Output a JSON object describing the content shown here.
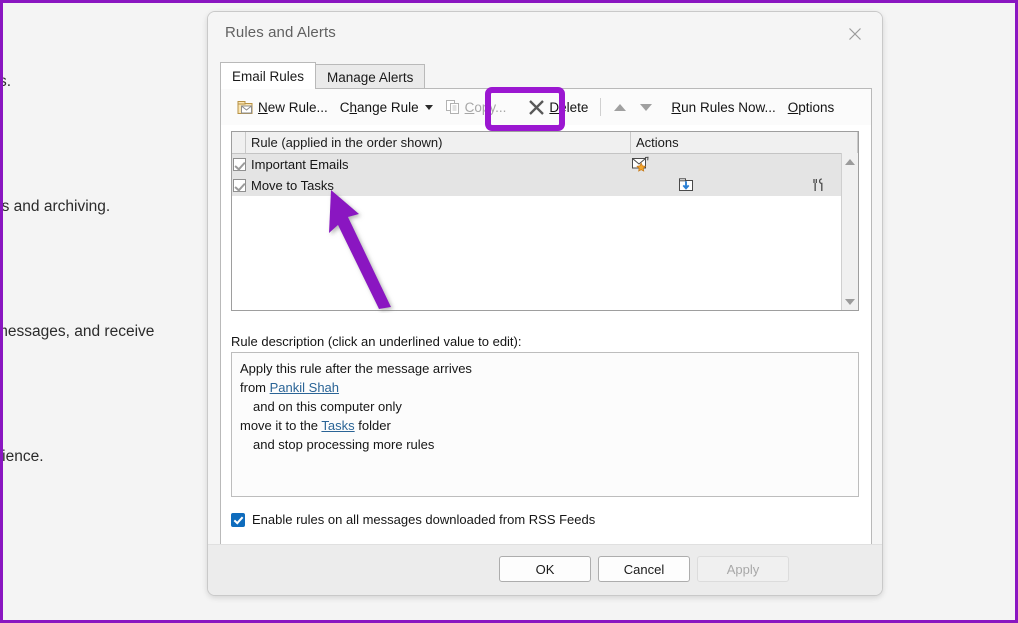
{
  "annotation": {
    "border_color": "#8a16c1",
    "highlight_color": "#9b17d1",
    "arrow_color": "#8a16c1",
    "highlight_target": "Delete",
    "arrow_target": "Move to Tasks"
  },
  "background_page": {
    "lines": [
      "s.",
      "ns and archiving.",
      "messages, and receive",
      "rience."
    ]
  },
  "dialog": {
    "title": "Rules and Alerts",
    "close_icon": "close-icon",
    "tabs": [
      {
        "label": "Email Rules",
        "active": true
      },
      {
        "label": "Manage Alerts",
        "active": false
      }
    ],
    "toolbar": {
      "new_rule": {
        "label": "New Rule...",
        "underline": "N",
        "icon": "new-rule-icon",
        "disabled": false
      },
      "change_rule": {
        "label": "Change Rule",
        "underline": "h",
        "icon": "chevron-down-icon",
        "disabled": false
      },
      "copy": {
        "label": "Copy...",
        "underline": "C",
        "icon": "copy-icon",
        "disabled": true
      },
      "delete": {
        "label": "Delete",
        "underline": "D",
        "icon": "delete-x-icon",
        "disabled": false
      },
      "move_up": {
        "icon": "triangle-up-icon",
        "disabled": true
      },
      "move_down": {
        "icon": "triangle-down-icon",
        "disabled": true
      },
      "run_rules_now": {
        "label": "Run Rules Now...",
        "underline": "R"
      },
      "options": {
        "label": "Options",
        "underline": "O"
      }
    },
    "rules_list": {
      "columns": [
        {
          "key": "check",
          "label": ""
        },
        {
          "key": "rule",
          "label": "Rule (applied in the order shown)"
        },
        {
          "key": "actions",
          "label": "Actions"
        }
      ],
      "rows": [
        {
          "checked": true,
          "name": "Important Emails",
          "selected": true,
          "action_icons": [
            "flag-message-icon"
          ]
        },
        {
          "checked": true,
          "name": "Move to Tasks",
          "selected": true,
          "action_icons": [
            "move-to-folder-icon",
            "tools-icon"
          ]
        }
      ],
      "scrollbar": {
        "up_icon": "scroll-up-icon",
        "down_icon": "scroll-down-icon"
      }
    },
    "description": {
      "label": "Rule description (click an underlined value to edit):",
      "lines": [
        {
          "text": "Apply this rule after the message arrives",
          "indent": false,
          "link": null
        },
        {
          "text": "from ",
          "indent": false,
          "link": "Pankil Shah",
          "after": ""
        },
        {
          "text": "and on this computer only",
          "indent": true,
          "link": null
        },
        {
          "text": "move it to the ",
          "indent": false,
          "link": "Tasks",
          "after": " folder"
        },
        {
          "text": "and stop processing more rules",
          "indent": true,
          "link": null
        }
      ]
    },
    "rss_option": {
      "label": "Enable rules on all messages downloaded from RSS Feeds",
      "checked": true,
      "check_color": "#0f6cbd"
    },
    "footer_buttons": [
      {
        "label": "OK",
        "disabled": false
      },
      {
        "label": "Cancel",
        "disabled": false
      },
      {
        "label": "Apply",
        "disabled": true
      }
    ]
  }
}
